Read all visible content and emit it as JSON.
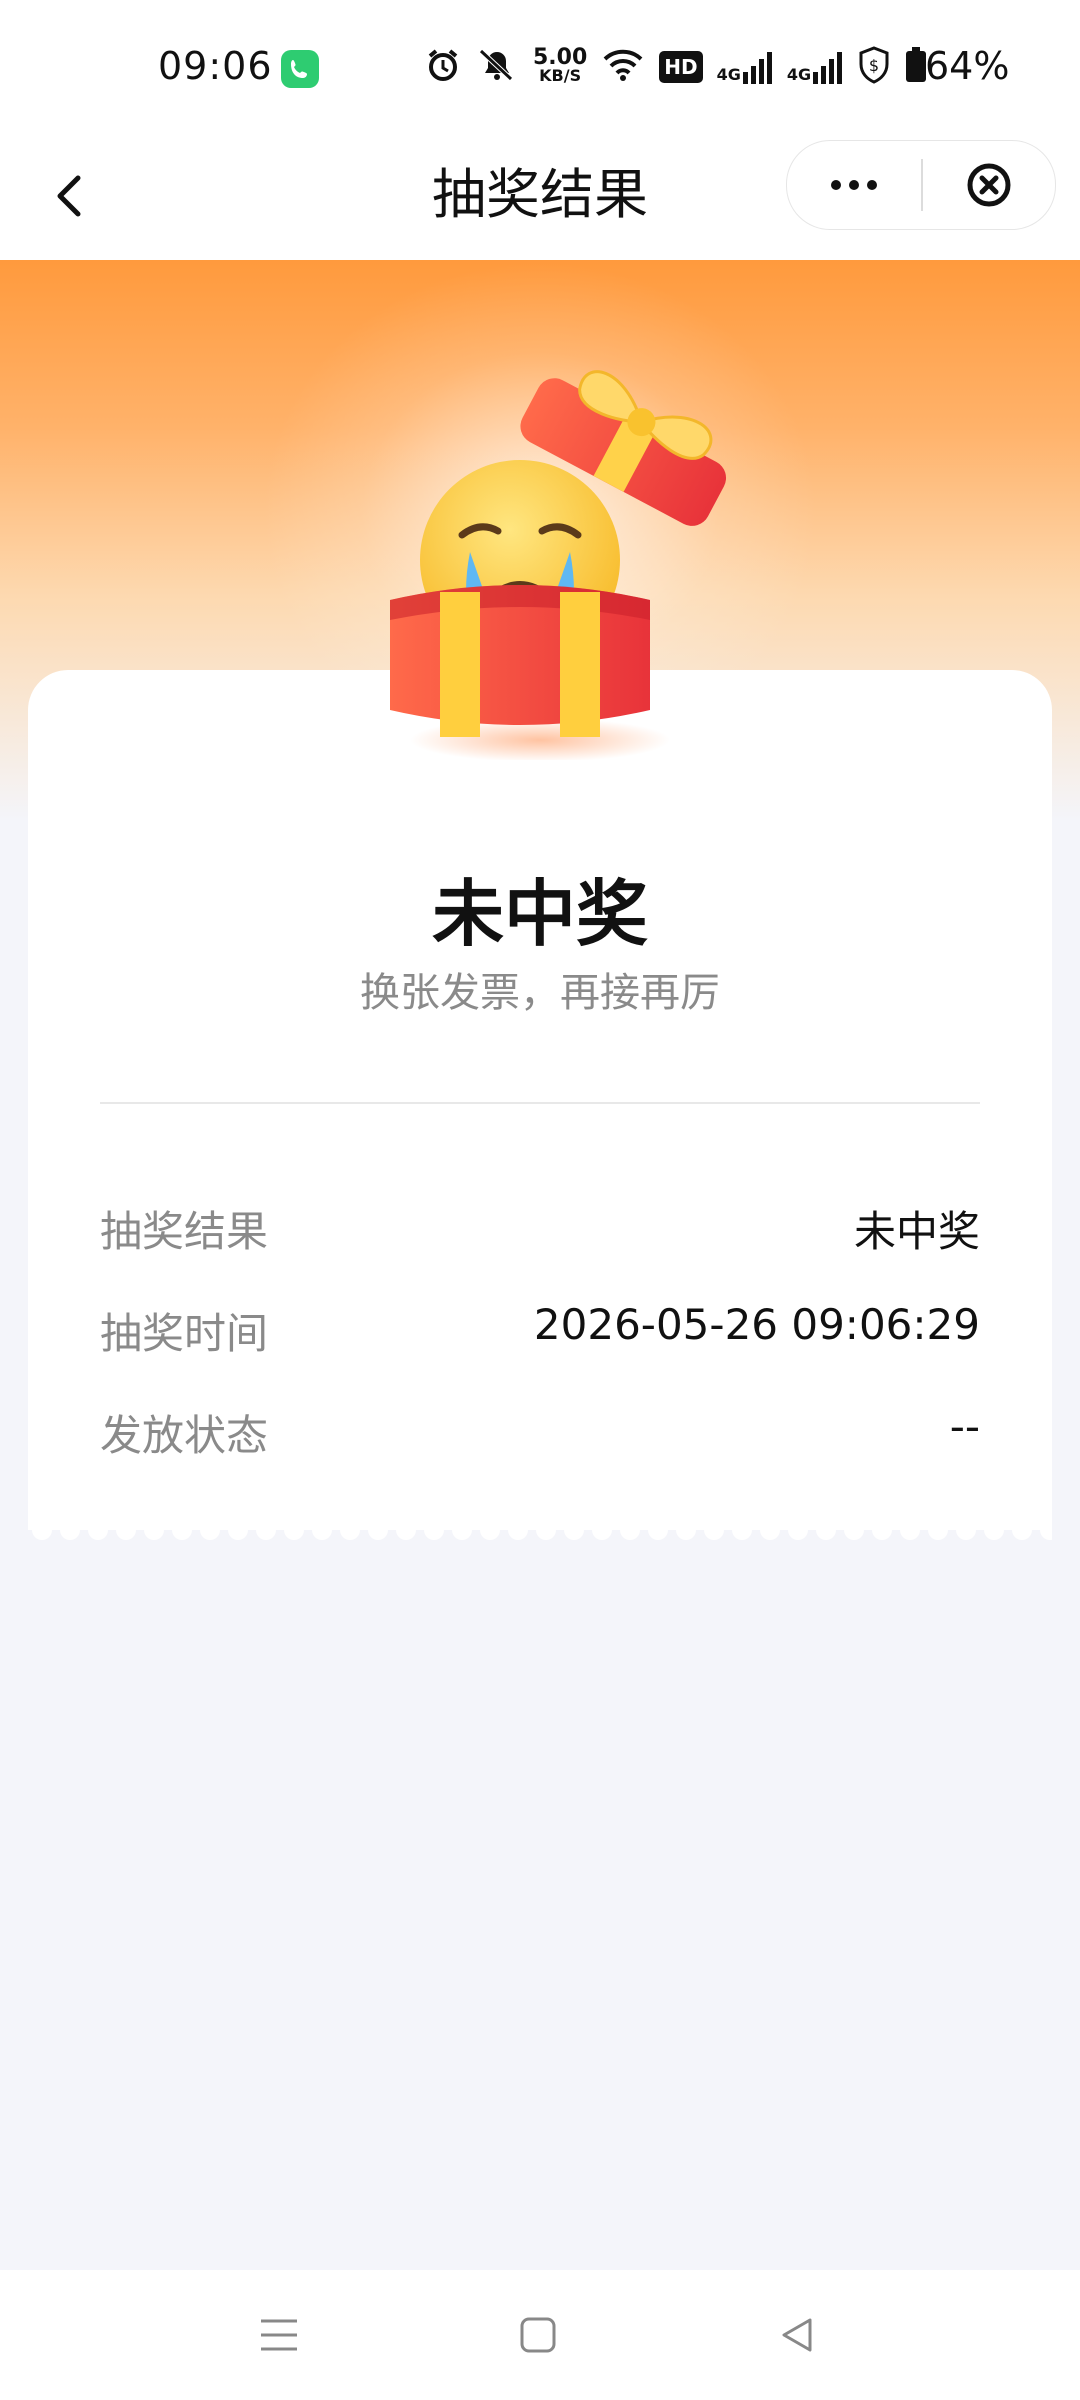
{
  "status_bar": {
    "time": "09:06",
    "net_speed_top": "5.00",
    "net_speed_bottom": "KB/S",
    "hd_label": "HD",
    "signal1": "4G",
    "signal2": "4G",
    "battery": "64%"
  },
  "nav": {
    "title": "抽奖结果"
  },
  "result": {
    "title": "未中奖",
    "subtitle": "换张发票，再接再厉"
  },
  "details": [
    {
      "label": "抽奖结果",
      "value": "未中奖"
    },
    {
      "label": "抽奖时间",
      "value": "2026-05-26 09:06:29"
    },
    {
      "label": "发放状态",
      "value": "--"
    }
  ],
  "colors": {
    "accent_orange": "#ff9a3d",
    "call_green": "#2ecc71",
    "page_bg": "#f4f5fa"
  },
  "icons": {
    "back": "back-chevron-icon",
    "more": "more-dots-icon",
    "close": "close-circle-icon",
    "gift": "sad-gift-illustration",
    "menu": "menu-icon",
    "home": "home-square-icon",
    "back_nav": "back-triangle-icon"
  }
}
